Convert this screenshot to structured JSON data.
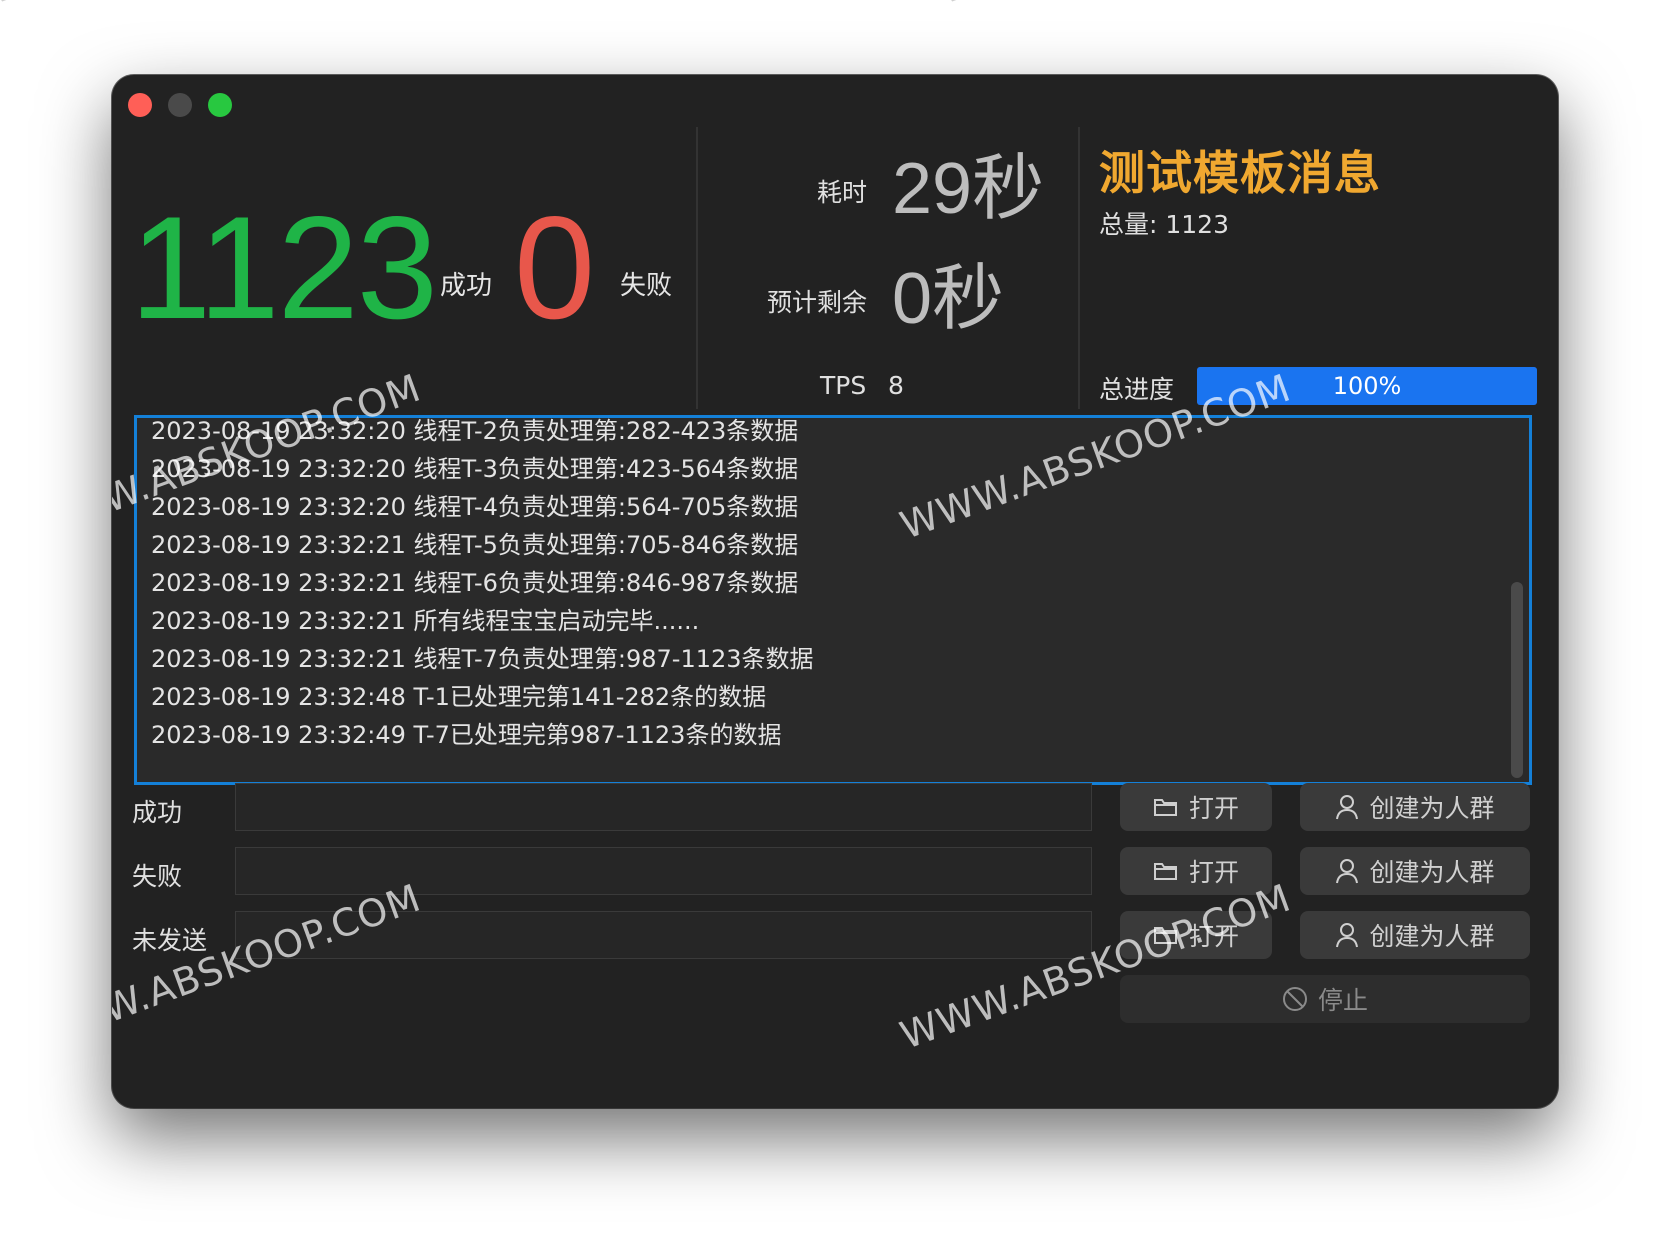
{
  "stats": {
    "success_count": "1123",
    "success_label": "成功",
    "fail_count": "0",
    "fail_label": "失败"
  },
  "timing": {
    "elapsed_label": "耗时",
    "elapsed_value": "29秒",
    "remaining_label": "预计剩余",
    "remaining_value": "0秒",
    "tps_label": "TPS",
    "tps_value": "8"
  },
  "task": {
    "title": "测试模板消息",
    "total_line": "总量: 1123",
    "progress_label": "总进度",
    "progress_text": "100%",
    "progress_fraction": 1.0,
    "progress_color": "#1a74f0"
  },
  "log": {
    "lines": [
      "2023-08-19 23:32:20 线程T-2负责处理第:282-423条数据",
      "2023-08-19 23:32:20 线程T-3负责处理第:423-564条数据",
      "2023-08-19 23:32:20 线程T-4负责处理第:564-705条数据",
      "2023-08-19 23:32:21 线程T-5负责处理第:705-846条数据",
      "2023-08-19 23:32:21 线程T-6负责处理第:846-987条数据",
      "2023-08-19 23:32:21 所有线程宝宝启动完毕......",
      "2023-08-19 23:32:21 线程T-7负责处理第:987-1123条数据",
      "2023-08-19 23:32:48 T-1已处理完第141-282条的数据",
      "2023-08-19 23:32:49 T-7已处理完第987-1123条的数据"
    ]
  },
  "outputs": {
    "success_label": "成功",
    "fail_label": "失败",
    "unsent_label": "未发送",
    "open_label": "打开",
    "create_crowd_label": "创建为人群",
    "stop_label": "停止"
  },
  "watermark": "WWW.ABSKOOP.COM",
  "colors": {
    "success": "#1fb447",
    "fail": "#e8574b",
    "title": "#f0a830",
    "accent": "#1480d8"
  },
  "icons": [
    "folder-icon",
    "user-icon",
    "stop-icon"
  ]
}
